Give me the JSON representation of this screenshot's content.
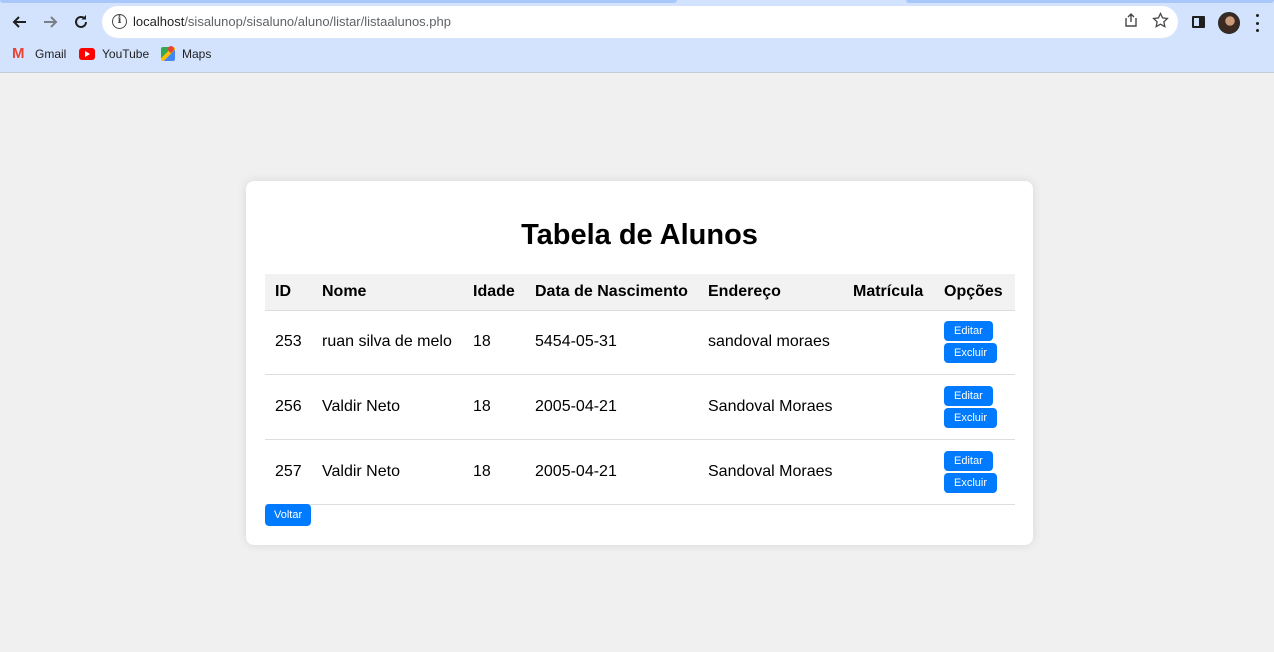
{
  "browser": {
    "url_host": "localhost",
    "url_path": "/sisalunop/sisaluno/aluno/listar/listaalunos.php",
    "bookmarks": [
      {
        "label": "Gmail",
        "icon": "gmail-icon"
      },
      {
        "label": "YouTube",
        "icon": "youtube-icon"
      },
      {
        "label": "Maps",
        "icon": "maps-icon"
      }
    ]
  },
  "page": {
    "title": "Tabela de Alunos",
    "columns": [
      "ID",
      "Nome",
      "Idade",
      "Data de Nascimento",
      "Endereço",
      "Matrícula",
      "Opções"
    ],
    "rows": [
      {
        "id": "253",
        "nome": "ruan silva de melo",
        "idade": "18",
        "nascimento": "5454-05-31",
        "endereco": "sandoval moraes",
        "matricula": ""
      },
      {
        "id": "256",
        "nome": "Valdir Neto",
        "idade": "18",
        "nascimento": "2005-04-21",
        "endereco": "Sandoval Moraes",
        "matricula": ""
      },
      {
        "id": "257",
        "nome": "Valdir Neto",
        "idade": "18",
        "nascimento": "2005-04-21",
        "endereco": "Sandoval Moraes",
        "matricula": ""
      }
    ],
    "edit_label": "Editar",
    "delete_label": "Excluir",
    "back_label": "Voltar"
  },
  "colors": {
    "accent": "#007bff",
    "page_background": "#f0f0f0",
    "header_row": "#f2f2f2",
    "chrome": "#d3e3fd"
  }
}
